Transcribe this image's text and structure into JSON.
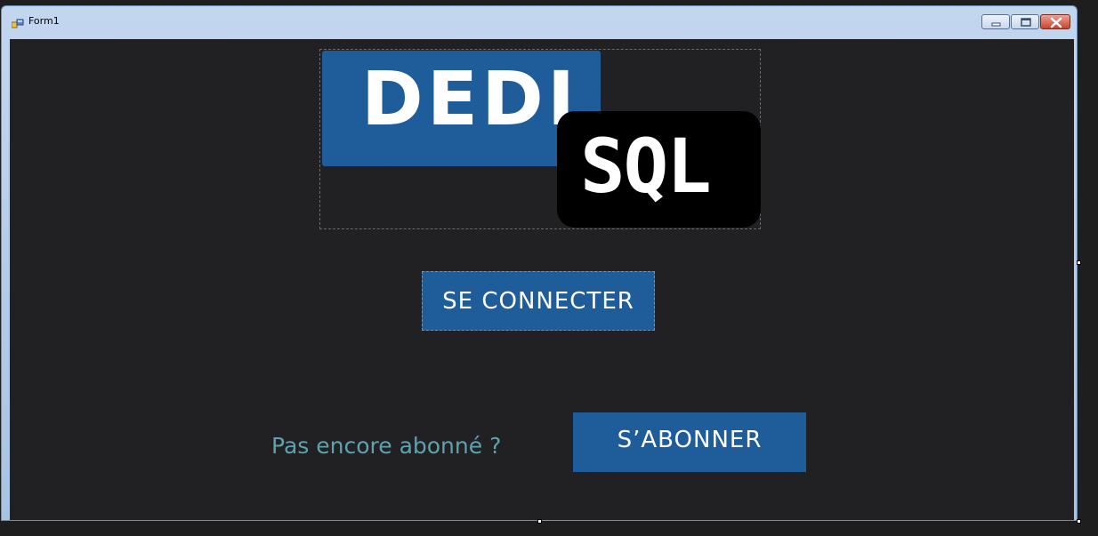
{
  "window": {
    "title": "Form1"
  },
  "logo": {
    "part1": "DEDI",
    "part2": "SQL"
  },
  "buttons": {
    "connect_label": "SE CONNECTER",
    "subscribe_label": "S’ABONNER"
  },
  "prompt": {
    "subscribe_text": "Pas encore abonné ?"
  },
  "colors": {
    "accent_blue": "#1f5c9a",
    "form_background": "#212023",
    "prompt_text": "#5ea2b0"
  },
  "icons": {
    "app": "form-icon",
    "minimize": "minimize-icon",
    "maximize": "maximize-icon",
    "close": "close-icon"
  }
}
